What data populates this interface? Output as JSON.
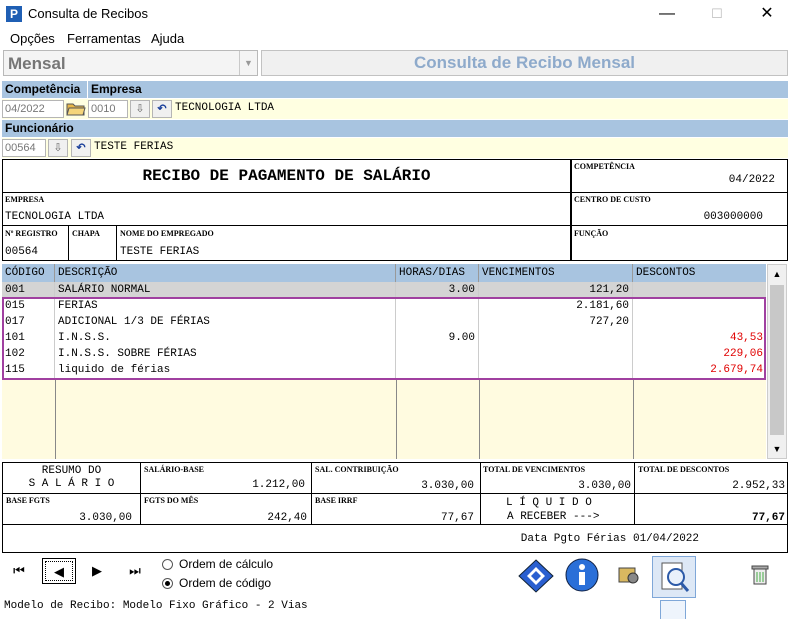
{
  "window": {
    "title": "Consulta de Recibos",
    "app_icon": "P",
    "minimize": "—",
    "maximize": "☐",
    "close": "✕"
  },
  "menu": [
    "Opções",
    "Ferramentas",
    "Ajuda"
  ],
  "mode": {
    "value": "Mensal",
    "arrow": "▼"
  },
  "header_title": "Consulta de Recibo Mensal",
  "labels": {
    "competencia": "Competência",
    "empresa": "Empresa",
    "funcionario": "Funcionário"
  },
  "filters": {
    "competencia": "04/2022",
    "empresa_code": "0010",
    "empresa_name": "TECNOLOGIA LTDA",
    "funcionario_code": "00564",
    "funcionario_name": "TESTE FERIAS"
  },
  "receipt": {
    "title": "RECIBO DE PAGAMENTO DE SALÁRIO",
    "competencia_label": "COMPETÊNCIA",
    "competencia": "04/2022",
    "empresa_label": "EMPRESA",
    "empresa": "TECNOLOGIA LTDA",
    "centro_label": "CENTRO DE CUSTO",
    "centro": "003000000",
    "registro_label": "Nº REGISTRO",
    "registro": "00564",
    "chapa_label": "CHAPA",
    "chapa": "",
    "empregado_label": "NOME DO EMPREGADO",
    "empregado": "TESTE FERIAS",
    "funcao_label": "FUNÇÃO",
    "funcao": ""
  },
  "table": {
    "headers": [
      "CÓDIGO",
      "DESCRIÇÃO",
      "HORAS/DIAS",
      "VENCIMENTOS",
      "DESCONTOS"
    ],
    "rows": [
      [
        "001",
        "SALÁRIO NORMAL",
        "3.00",
        "121,20",
        ""
      ],
      [
        "015",
        "FERIAS",
        "",
        "2.181,60",
        ""
      ],
      [
        "017",
        "ADICIONAL 1/3 DE FÉRIAS",
        "",
        "727,20",
        ""
      ],
      [
        "101",
        "I.N.S.S.",
        "9.00",
        "",
        "43,53"
      ],
      [
        "102",
        "I.N.S.S. SOBRE FÉRIAS",
        "",
        "",
        "229,06"
      ],
      [
        "115",
        "liquido de férias",
        "",
        "",
        "2.679,74"
      ]
    ]
  },
  "summary": {
    "resumo_l1": "RESUMO DO",
    "resumo_l2": "S A L Á R I O",
    "salario_base_label": "SALÁRIO-BASE",
    "salario_base": "1.212,00",
    "sal_contrib_label": "SAL. CONTRIBUIÇÃO",
    "sal_contrib": "3.030,00",
    "total_venc_label": "TOTAL DE VENCIMENTOS",
    "total_venc": "3.030,00",
    "total_desc_label": "TOTAL DE DESCONTOS",
    "total_desc": "2.952,33",
    "base_fgts_label": "BASE FGTS",
    "base_fgts": "3.030,00",
    "fgts_mes_label": "FGTS DO MÊS",
    "fgts_mes": "242,40",
    "base_irrf_label": "BASE IRRF",
    "base_irrf": "77,67",
    "liquido_l1": "L Í Q U I D O",
    "liquido_l2": "A RECEBER --->",
    "liquido": "77,67",
    "data_pgto": "Data Pgto Férias 01/04/2022"
  },
  "nav": {
    "first": "⏮",
    "prev": "◀",
    "next": "▶",
    "last": "⏭"
  },
  "order": {
    "calc": "Ordem de cálculo",
    "code": "Ordem de código",
    "selected": "code"
  },
  "status": "Modelo de Recibo: Modelo Fixo Gráfico - 2 Vias",
  "colors": {
    "label_bar": "#a8c4e0",
    "highlight": "#a040a0",
    "discount": "#e00000"
  }
}
